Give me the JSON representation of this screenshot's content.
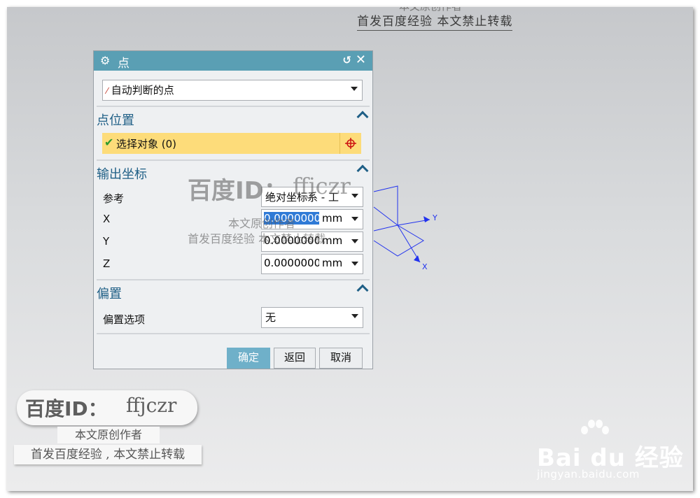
{
  "watermark_top": {
    "faint": "本文原创作者",
    "line": "首发百度经验  本文禁止转载"
  },
  "dialog": {
    "title": "点",
    "type_select": {
      "value": "自动判断的点"
    },
    "sections": {
      "position": "点位置",
      "output": "输出坐标",
      "offset": "偏置"
    },
    "select_object": {
      "label": "选择对象 (0)"
    },
    "reference": {
      "label": "参考",
      "value": "绝对坐标系 - 工"
    },
    "coords": [
      {
        "axis": "X",
        "value": "0.0000000",
        "unit": "mm"
      },
      {
        "axis": "Y",
        "value": "0.0000000",
        "unit": "mm"
      },
      {
        "axis": "Z",
        "value": "0.0000000",
        "unit": "mm"
      }
    ],
    "offset_option": {
      "label": "偏置选项",
      "value": "无"
    },
    "buttons": {
      "ok": "确定",
      "back": "返回",
      "cancel": "取消"
    }
  },
  "axes_triad": {
    "y_label": "Y",
    "x_label": "X",
    "color": "#2233ee"
  },
  "watermark_mid": {
    "brand": "百度ID：",
    "user": "ffjczr",
    "line1": "本文原创作者",
    "line2": "首发百度经验  本文禁止转载"
  },
  "watermark_bottom_left": {
    "brand": "百度ID：",
    "user": "ffjczr",
    "author": "本文原创作者",
    "line": "首发百度经验 , 本文禁止转载"
  },
  "baidu_logo": {
    "word": "Bai du 经验",
    "url": "jingyan.baidu.com"
  }
}
